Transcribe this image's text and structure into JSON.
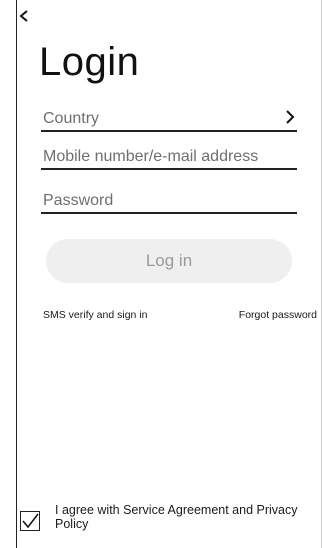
{
  "header": {
    "back_icon": "chevron-left-icon",
    "title": "Login"
  },
  "form": {
    "country_placeholder": "Country",
    "country_icon": "chevron-right-icon",
    "account_placeholder": "Mobile number/e-mail address",
    "password_placeholder": "Password",
    "login_label": "Log in"
  },
  "links": {
    "sms_label": "SMS verify and sign in",
    "forgot_label": "Forgot password"
  },
  "agreement": {
    "checked": true,
    "text": "I agree with Service Agreement and Privacy Policy"
  },
  "colors": {
    "button_bg": "#efefef",
    "button_text": "#9a9a9a",
    "placeholder_text": "#6f6f6f",
    "underline": "#222222"
  }
}
